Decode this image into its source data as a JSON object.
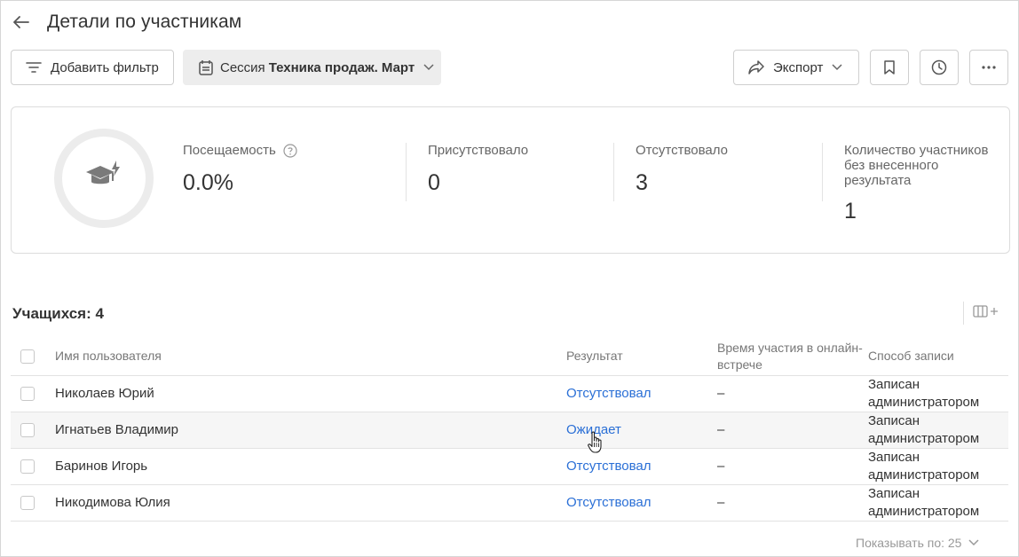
{
  "header": {
    "title": "Детали по участникам"
  },
  "toolbar": {
    "filter_label": "Добавить фильтр",
    "session_prefix": "Сессия",
    "session_name": "Техника продаж. Март",
    "export_label": "Экспорт"
  },
  "stats": {
    "attendance": {
      "label": "Посещаемость",
      "value": "0.0%"
    },
    "present": {
      "label": "Присутствовало",
      "value": "0"
    },
    "absent": {
      "label": "Отсутствовало",
      "value": "3"
    },
    "no_result": {
      "label": "Количество участников без внесенного результата",
      "value": "1"
    }
  },
  "list": {
    "title": "Учащихся: 4",
    "columns": [
      "Имя пользователя",
      "Результат",
      "Время участия в онлайн-встрече",
      "Способ записи"
    ],
    "rows": [
      {
        "name": "Николаев Юрий",
        "result": "Отсутствовал",
        "time": "–",
        "method": "Записан администратором"
      },
      {
        "name": "Игнатьев Владимир",
        "result": "Ожидает",
        "time": "–",
        "method": "Записан администратором"
      },
      {
        "name": "Баринов Игорь",
        "result": "Отсутствовал",
        "time": "–",
        "method": "Записан администратором"
      },
      {
        "name": "Никодимова Юлия",
        "result": "Отсутствовал",
        "time": "–",
        "method": "Записан администратором"
      }
    ]
  },
  "pager": {
    "label": "Показывать по: 25"
  },
  "colors": {
    "link": "#2a6fd6",
    "text": "#333333",
    "muted": "#777777",
    "hover_row": "#f6f6f6"
  }
}
